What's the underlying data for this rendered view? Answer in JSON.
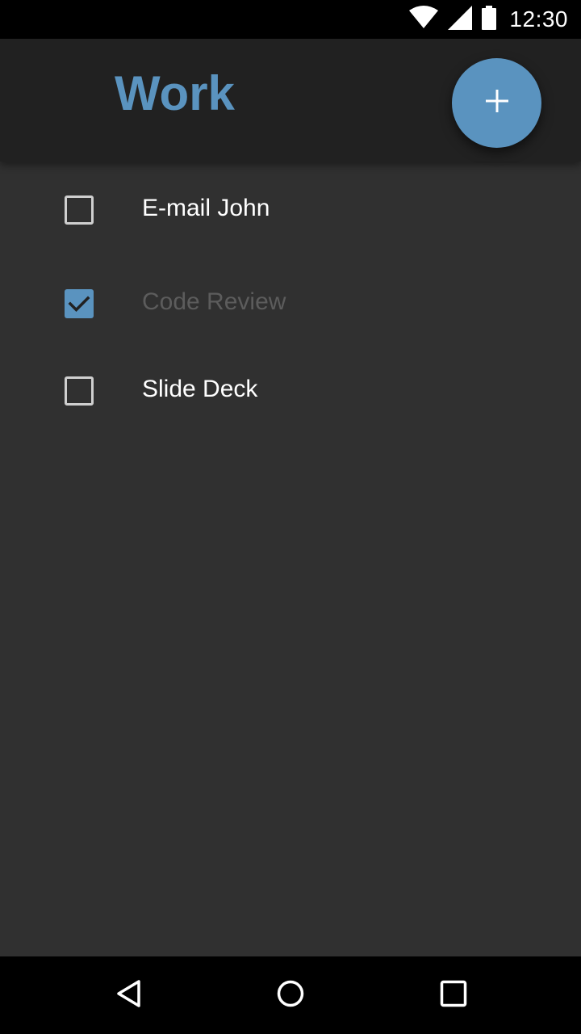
{
  "status_bar": {
    "time": "12:30",
    "icons": [
      "wifi-icon",
      "cell-signal-icon",
      "battery-icon"
    ]
  },
  "toolbar": {
    "title": "Work",
    "add_button_icon": "plus-icon"
  },
  "tasks": [
    {
      "label": "E-mail John",
      "checked": false
    },
    {
      "label": "Code Review",
      "checked": true
    },
    {
      "label": "Slide Deck",
      "checked": false
    }
  ],
  "nav_bar": {
    "icons": [
      "back-icon",
      "home-icon",
      "recents-icon"
    ]
  },
  "colors": {
    "accent": "#5a93bf",
    "toolbar_bg": "#212121",
    "content_bg": "#303030",
    "text_primary": "#ffffff",
    "text_done": "#5c5c5c"
  }
}
